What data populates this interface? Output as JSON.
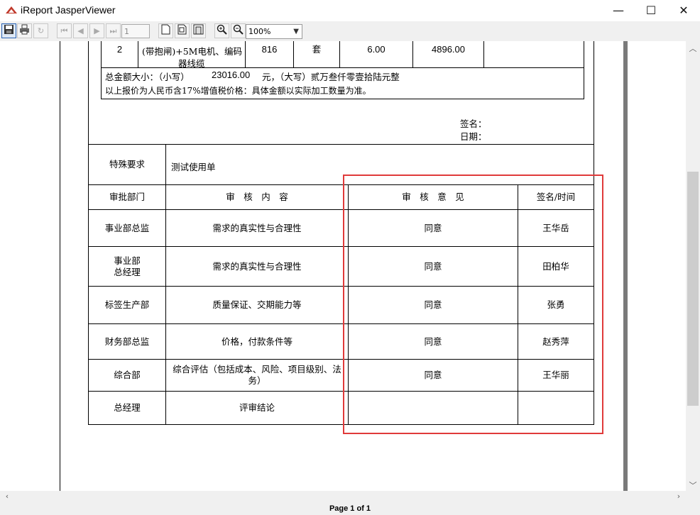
{
  "window": {
    "title": "iReport JasperViewer",
    "minimize": "—",
    "maximize": "☐",
    "close": "✕"
  },
  "toolbar": {
    "page_number": "1",
    "zoom": "100%"
  },
  "status": {
    "page_info": "Page 1 of 1"
  },
  "items_row": {
    "index": "2",
    "name_line1": "(带抱闸)+5M电机、编码",
    "name_line2": "器线缆",
    "qty": "816",
    "unit": "套",
    "price": "6.00",
    "amount": "4896.00",
    "remark": ""
  },
  "totals": {
    "label": "总金额大小：（小写）",
    "amount": "23016.00",
    "unit_and_caps_label": "元，（大写）贰万叁仟零壹拾陆元整",
    "note": "以上报价为人民币含17%增值税价格：具体金额以实际加工数量为准。"
  },
  "signature": {
    "sign_label": "签名：",
    "date_label": "日期："
  },
  "special": {
    "label": "特殊要求",
    "value": "测试使用单"
  },
  "approval": {
    "headers": {
      "dept": "审批部门",
      "content": "审　核　内　容",
      "opinion": "审　核　意　见",
      "sign_time": "签名/时间"
    },
    "rows": [
      {
        "dept": "事业部总监",
        "content": "需求的真实性与合理性",
        "opinion": "同意",
        "signer": "王华岳"
      },
      {
        "dept": "事业部\n总经理",
        "content": "需求的真实性与合理性",
        "opinion": "同意",
        "signer": "田柏华"
      },
      {
        "dept": "标签生产部",
        "content": "质量保证、交期能力等",
        "opinion": "同意",
        "signer": "张勇"
      },
      {
        "dept": "财务部总监",
        "content": "价格，付款条件等",
        "opinion": "同意",
        "signer": "赵秀萍"
      },
      {
        "dept": "综合部",
        "content": "综合评估（包括成本、风险、项目级别、法务）",
        "opinion": "同意",
        "signer": "王华丽"
      },
      {
        "dept": "总经理",
        "content": "评审结论",
        "opinion": "",
        "signer": ""
      }
    ]
  },
  "colors": {
    "highlight": "#e03a3a",
    "chrome": "#f0f0f0"
  }
}
